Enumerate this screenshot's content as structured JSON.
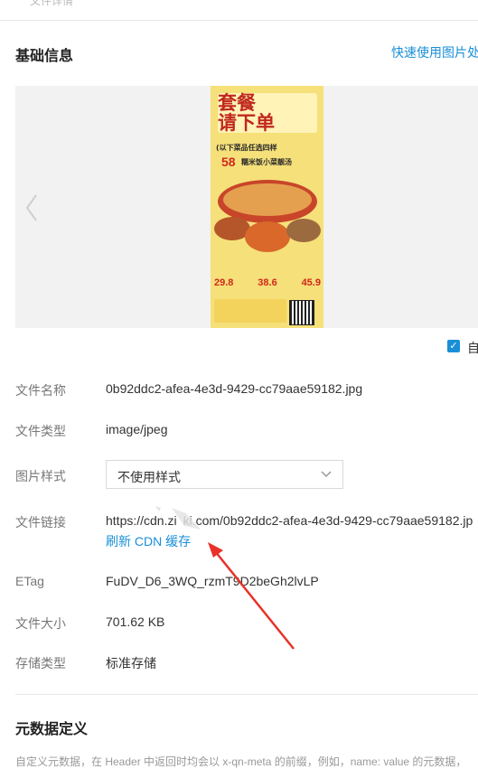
{
  "header": {
    "cut_text": "文件详情"
  },
  "basic_info": {
    "title": "基础信息",
    "quick_link": "快速使用图片处理",
    "preview": {
      "poster": {
        "headline": "套餐\n请下单",
        "subline": "(以下菜品任选四样",
        "price_tag": "58",
        "line2": "糯米饭小菜靓汤",
        "prices": [
          "29.8",
          "38.6",
          "45.9"
        ]
      }
    },
    "checkbox_label": "自",
    "rows": {
      "file_name": {
        "label": "文件名称",
        "value": "0b92ddc2-afea-4e3d-9429-cc79aae59182.jpg"
      },
      "file_type": {
        "label": "文件类型",
        "value": "image/jpeg"
      },
      "image_style": {
        "label": "图片样式",
        "value": "不使用样式"
      },
      "file_link": {
        "label": "文件链接",
        "value": "https://cdn.zi ki.com/0b92ddc2-afea-4e3d-9429-cc79aae59182.jp",
        "refresh": "刷新 CDN 缓存"
      },
      "etag": {
        "label": "ETag",
        "value": "FuDV_D6_3WQ_rzmT9D2beGh2lvLP"
      },
      "file_size": {
        "label": "文件大小",
        "value": "701.62 KB"
      },
      "storage_type": {
        "label": "存储类型",
        "value": "标准存储"
      }
    }
  },
  "metadata": {
    "title": "元数据定义",
    "description": "自定义元数据，在 Header 中返回时均会以 x-qn-meta 的前缀，例如，name: value 的元数据，"
  },
  "colors": {
    "accent": "#1a8fd8",
    "annotation": "#e8312a"
  },
  "icons": {
    "prev": "chevron-left-icon",
    "select": "chevron-down-icon",
    "check": "checkmark-icon"
  }
}
